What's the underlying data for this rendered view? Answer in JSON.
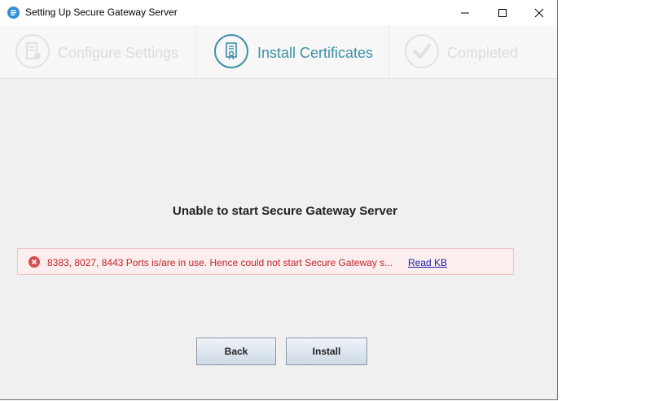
{
  "window": {
    "title": "Setting Up Secure Gateway Server"
  },
  "steps": [
    {
      "label": "Configure Settings",
      "icon": "server-settings-icon",
      "state": "inactive"
    },
    {
      "label": "Install Certificates",
      "icon": "certificate-icon",
      "state": "active"
    },
    {
      "label": "Completed",
      "icon": "checkmark-icon",
      "state": "inactive"
    }
  ],
  "main": {
    "heading": "Unable to start Secure Gateway Server",
    "error": {
      "message": "8383, 8027, 8443 Ports is/are in use. Hence could not start Secure Gateway s...",
      "link": "Read KB"
    }
  },
  "buttons": {
    "back": "Back",
    "install": "Install"
  },
  "colors": {
    "accent": "#3d8fa6",
    "error": "#c0262a",
    "error_bg": "#fceeee"
  }
}
